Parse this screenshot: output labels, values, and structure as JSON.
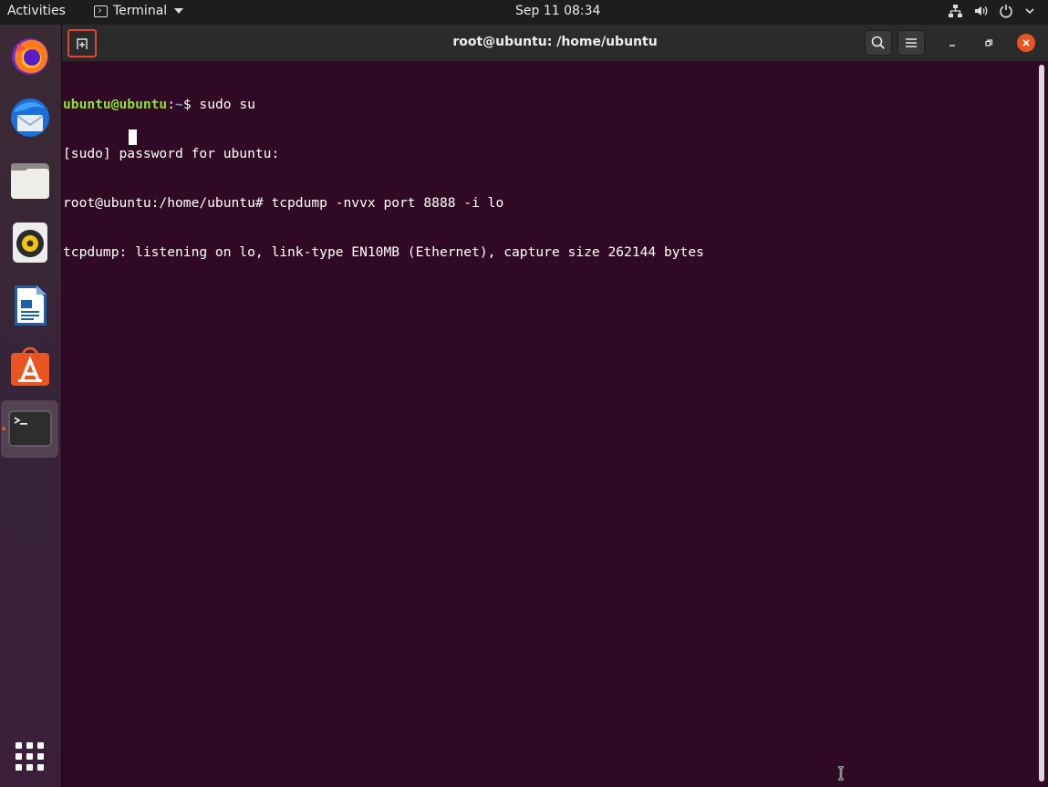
{
  "topbar": {
    "activities": "Activities",
    "app_menu": "Terminal",
    "clock": "Sep 11  08:34",
    "tray_icons": [
      "network-icon",
      "volume-icon",
      "power-icon",
      "chevron-down-icon"
    ]
  },
  "dock": {
    "items": [
      {
        "name": "Firefox",
        "icon": "firefox-icon"
      },
      {
        "name": "Thunderbird",
        "icon": "thunderbird-icon"
      },
      {
        "name": "Files",
        "icon": "files-icon"
      },
      {
        "name": "Rhythmbox",
        "icon": "rhythmbox-icon"
      },
      {
        "name": "LibreOffice Writer",
        "icon": "writer-icon"
      },
      {
        "name": "Ubuntu Software",
        "icon": "software-icon"
      },
      {
        "name": "Terminal",
        "icon": "terminal-icon",
        "active": true
      }
    ],
    "show_apps_icon": "app-grid-icon"
  },
  "window": {
    "title": "root@ubuntu: /home/ubuntu",
    "new_tab_icon": "new-tab-icon",
    "search_icon": "search-icon",
    "menu_icon": "hamburger-icon"
  },
  "terminal": {
    "prompt_user": "ubuntu@ubuntu",
    "prompt_sep": ":",
    "prompt_path": "~",
    "prompt_symbol": "$ ",
    "command1": "sudo su",
    "line2": "[sudo] password for ubuntu:",
    "line3": "root@ubuntu:/home/ubuntu# tcpdump -nvvx port 8888 -i lo",
    "line4": "tcpdump: listening on lo, link-type EN10MB (Ethernet), capture size 262144 bytes"
  },
  "colors": {
    "terminal_bg": "#300a24",
    "prompt_user": "#8ae234",
    "prompt_path": "#729fcf",
    "accent": "#e95420"
  }
}
